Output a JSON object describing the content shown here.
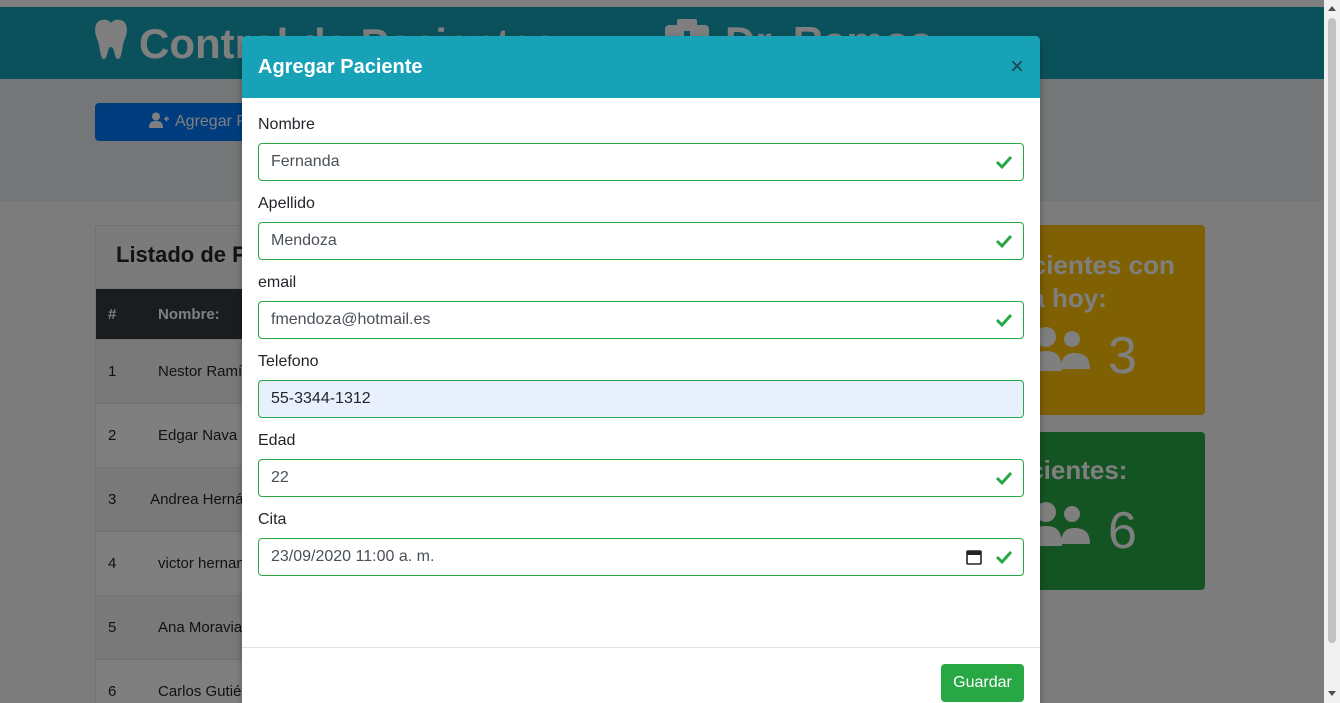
{
  "app": {
    "header_title": "Control de Pacientes",
    "header_doctor": "Dr. Ramos"
  },
  "toolbar": {
    "add_button_label": "Agregar Paciente"
  },
  "list": {
    "title": "Listado de Pacientes",
    "columns": [
      "#",
      "Nombre:"
    ],
    "rows": [
      {
        "num": "1",
        "name": "Nestor Ramírez"
      },
      {
        "num": "2",
        "name": "Edgar Nava"
      },
      {
        "num": "3",
        "name": "Andrea Hernández"
      },
      {
        "num": "4",
        "name": "victor hernandez"
      },
      {
        "num": "5",
        "name": "Ana Moravia"
      },
      {
        "num": "6",
        "name": "Carlos Gutiérrez"
      }
    ]
  },
  "stats": {
    "today_title_1": "Pacientes con",
    "today_title_2": "cita hoy:",
    "today_value": "3",
    "total_title": "Total Pacientes:",
    "total_value": "6"
  },
  "modal": {
    "title": "Agregar Paciente",
    "close": "×",
    "fields": [
      {
        "label": "Nombre",
        "value": "Fernanda"
      },
      {
        "label": "Apellido",
        "value": "Mendoza"
      },
      {
        "label": "email",
        "value": "fmendoza@hotmail.es"
      },
      {
        "label": "Telefono",
        "value": "55-3344-1312"
      },
      {
        "label": "Edad",
        "value": "22"
      },
      {
        "label": "Cita",
        "value": "23/09/2020 11:00 a. m."
      }
    ],
    "save_label": "Guardar"
  },
  "colors": {
    "header": "#17a2b8",
    "valid": "#28a745",
    "stat_yellow": "#ffc107",
    "stat_green": "#28a745",
    "primary": "#007bff"
  },
  "icons": [
    "tooth-icon",
    "clinic-icon",
    "user-plus-icon",
    "users-icon",
    "check-icon",
    "calendar-icon"
  ]
}
